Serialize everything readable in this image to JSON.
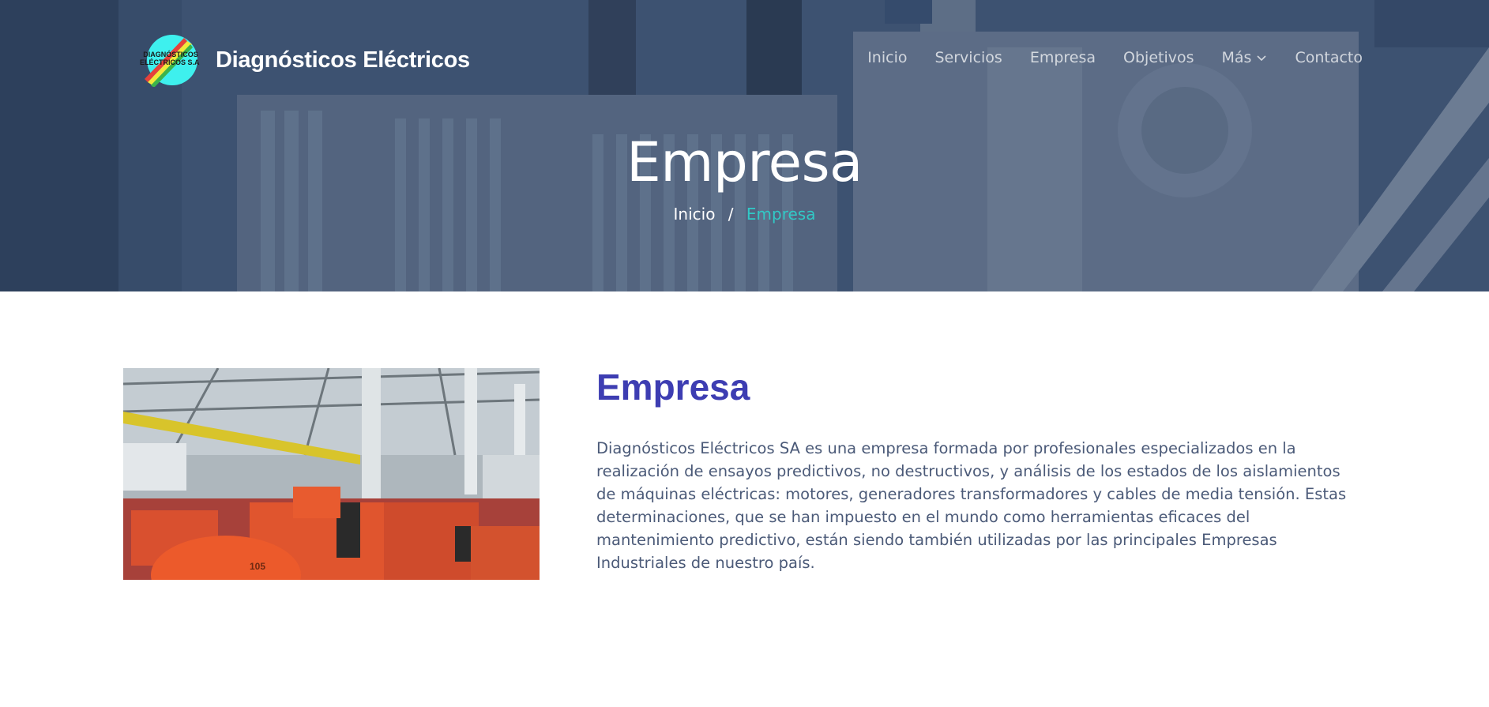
{
  "brand": {
    "name": "Diagnósticos Eléctricos",
    "badge_line1": "DIAGNÓSTICOS",
    "badge_line2": "ELÉCTRICOS S.A."
  },
  "nav": {
    "items": [
      {
        "label": "Inicio"
      },
      {
        "label": "Servicios"
      },
      {
        "label": "Empresa"
      },
      {
        "label": "Objetivos"
      },
      {
        "label": "Más",
        "icon": "chevron-down-icon"
      },
      {
        "label": "Contacto"
      }
    ]
  },
  "hero": {
    "title": "Empresa",
    "breadcrumb": {
      "home": "Inicio",
      "separator": "/",
      "current": "Empresa"
    }
  },
  "about": {
    "title": "Empresa",
    "text": "Diagnósticos Eléctricos SA es una empresa formada por profesionales especializados en la realización de ensayos predictivos, no destructivos, y análisis de los estados de los aislamientos de máquinas eléctricas: motores, generadores transformadores y cables de media tensión. Estas determinaciones, que se han impuesto en el mundo como herramientas eficaces del mantenimiento predictivo, están siendo también utilizadas por las principales Empresas Industriales de nuestro país.",
    "image_label": "105"
  },
  "colors": {
    "accent": "#31c9c6",
    "title": "#3d3db2",
    "body_text": "#4b5a78",
    "logo_circle": "#3ef0ee"
  }
}
